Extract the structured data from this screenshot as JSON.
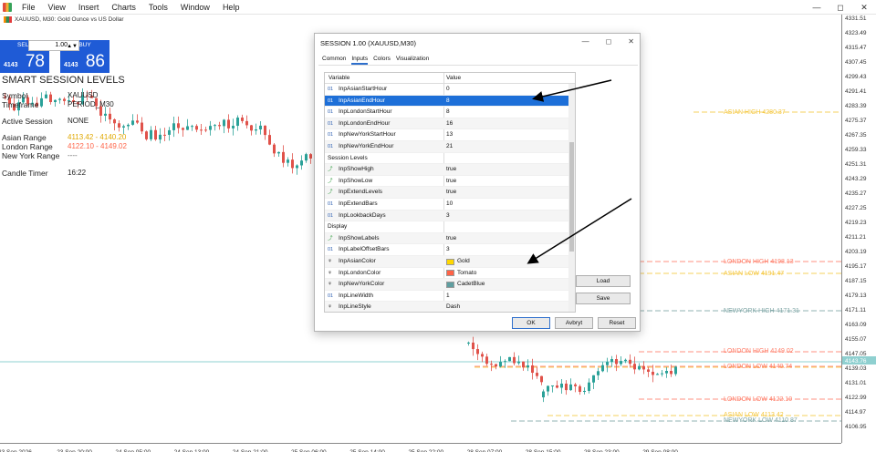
{
  "menu": {
    "items": [
      "File",
      "View",
      "Insert",
      "Charts",
      "Tools",
      "Window",
      "Help"
    ],
    "controls": [
      "—",
      "◻",
      "✕"
    ]
  },
  "chart": {
    "title": "XAUUSD, M30:  Gold Ounce vs US Dollar",
    "current_price_label": "4143.76",
    "price_ticks": [
      "4331.51",
      "4323.49",
      "4315.47",
      "4307.45",
      "4299.43",
      "4291.41",
      "4283.39",
      "4275.37",
      "4267.35",
      "4259.33",
      "4251.31",
      "4243.29",
      "4235.27",
      "4227.25",
      "4219.23",
      "4211.21",
      "4203.19",
      "4195.17",
      "4187.15",
      "4179.13",
      "4171.11",
      "4163.09",
      "4155.07",
      "4147.05",
      "4139.03",
      "4131.01",
      "4122.99",
      "4114.97",
      "4106.95"
    ],
    "time_ticks": [
      "23 Sep 2026",
      "23 Sep 20:00",
      "24 Sep 05:00",
      "24 Sep 13:00",
      "24 Sep 21:00",
      "25 Sep 06:00",
      "25 Sep 14:00",
      "25 Sep 22:00",
      "28 Sep 07:00",
      "28 Sep 15:00",
      "28 Sep 23:00",
      "29 Sep 08:00"
    ],
    "levels": [
      {
        "label": "ASIAN HIGH 4280.37",
        "color": "#f5c842"
      },
      {
        "label": "LONDON HIGH 4198.13",
        "color": "#ff7f6a"
      },
      {
        "label": "ASIAN LOW 4191.47",
        "color": "#f5c842"
      },
      {
        "label": "NEWYORK HIGH 4171.31",
        "color": "#7fa6a6"
      },
      {
        "label": "LONDON HIGH 4149.02",
        "color": "#ff7f6a"
      },
      {
        "label": "LONDON LOW 4140.74",
        "color": "#ff7f6a"
      },
      {
        "label": "LONDON LOW 4122.10",
        "color": "#ff7f6a"
      },
      {
        "label": "ASIAN LOW 4113.42",
        "color": "#f5c842"
      },
      {
        "label": "NEWYORK LOW 4110.87",
        "color": "#7fa6a6"
      }
    ]
  },
  "trade_panel": {
    "sell_label": "SELL",
    "buy_label": "BUY",
    "lot": "1.00",
    "sell_small": "4143",
    "sell_big": "78",
    "buy_small": "4143",
    "buy_big": "86"
  },
  "info_panel": {
    "title": "SMART SESSION LEVELS",
    "symbol_label": "Symbol",
    "symbol_value": "XAUUSD",
    "timeframe_label": "Timeframe",
    "timeframe_value": "PERIOD_M30",
    "active_session_label": "Active Session",
    "active_session_value": "NONE",
    "asian_range_label": "Asian Range",
    "asian_range_value": "4113.42 - 4140.20",
    "london_range_label": "London Range",
    "london_range_value": "4122.10 - 4149.02",
    "newyork_range_label": "New York Range",
    "newyork_range_value": "----",
    "candle_timer_label": "Candle Timer",
    "candle_timer_value": "16:22"
  },
  "dialog": {
    "title": "SESSION 1.00 (XAUUSD,M30)",
    "tabs": [
      "Common",
      "Inputs",
      "Colors",
      "Visualization"
    ],
    "active_tab": "Inputs",
    "col_variable": "Variable",
    "col_value": "Value",
    "rows": [
      {
        "type": "int",
        "name": "InpAsianStartHour",
        "value": "0"
      },
      {
        "type": "int",
        "name": "InpAsianEndHour",
        "value": "8",
        "selected": true
      },
      {
        "type": "int",
        "name": "InpLondonStartHour",
        "value": "8"
      },
      {
        "type": "int",
        "name": "InpLondonEndHour",
        "value": "16"
      },
      {
        "type": "int",
        "name": "InpNewYorkStartHour",
        "value": "13"
      },
      {
        "type": "int",
        "name": "InpNewYorkEndHour",
        "value": "21"
      },
      {
        "type": "section",
        "name": "Session Levels",
        "value": ""
      },
      {
        "type": "bool",
        "name": "InpShowHigh",
        "value": "true"
      },
      {
        "type": "bool",
        "name": "InpShowLow",
        "value": "true"
      },
      {
        "type": "bool",
        "name": "InpExtendLevels",
        "value": "true"
      },
      {
        "type": "int",
        "name": "InpExtendBars",
        "value": "10"
      },
      {
        "type": "int",
        "name": "InpLookbackDays",
        "value": "3"
      },
      {
        "type": "section",
        "name": "Display",
        "value": ""
      },
      {
        "type": "bool",
        "name": "InpShowLabels",
        "value": "true"
      },
      {
        "type": "int",
        "name": "InpLabelOffsetBars",
        "value": "3"
      },
      {
        "type": "color",
        "name": "InpAsianColor",
        "value": "Gold",
        "swatch": "#ffd700"
      },
      {
        "type": "color",
        "name": "InpLondonColor",
        "value": "Tomato",
        "swatch": "#ff6347"
      },
      {
        "type": "color",
        "name": "InpNewYorkColor",
        "value": "CadetBlue",
        "swatch": "#5f9ea0"
      },
      {
        "type": "int",
        "name": "InpLineWidth",
        "value": "1"
      },
      {
        "type": "color",
        "name": "InpLineStyle",
        "value": "Dash"
      }
    ],
    "load_label": "Load",
    "save_label": "Save",
    "ok_label": "OK",
    "cancel_label": "Avbryt",
    "reset_label": "Reset"
  },
  "colors": {
    "bull": "#2aa198",
    "bear": "#e0524a",
    "asian": "#f5c842",
    "london": "#ff7f6a",
    "newyork": "#7fa6a6",
    "accent": "#1d6fd8"
  }
}
